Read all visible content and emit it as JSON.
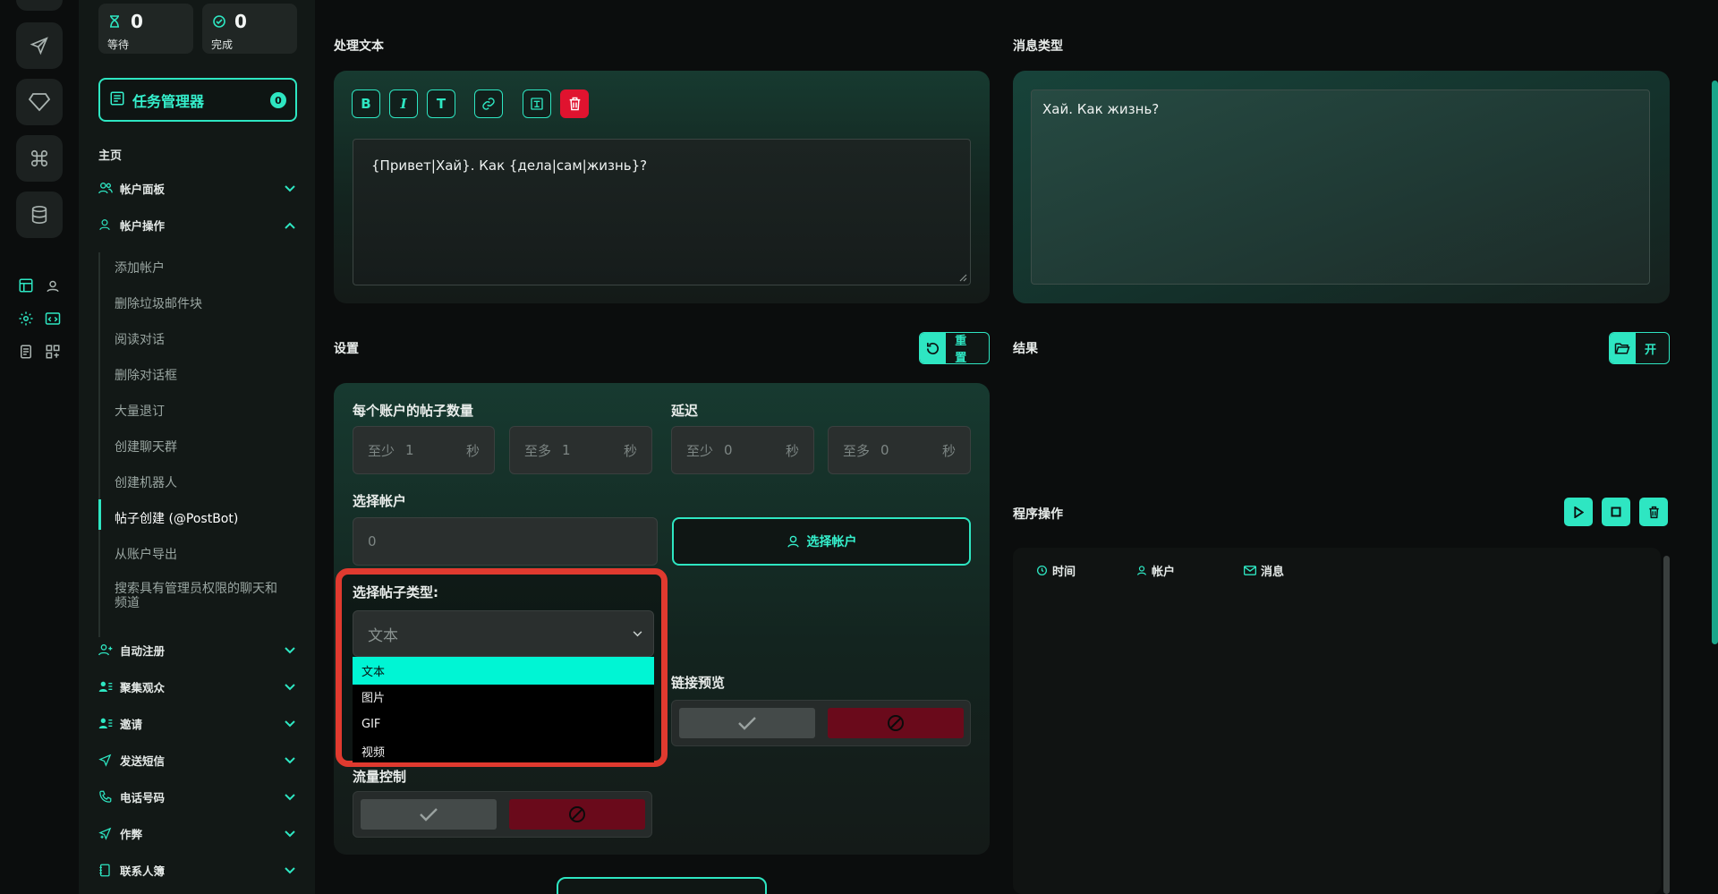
{
  "stats": [
    {
      "icon": "hourglass-icon",
      "value": "0",
      "label": "等待"
    },
    {
      "icon": "check-circle-icon",
      "value": "0",
      "label": "完成"
    }
  ],
  "task_manager": {
    "label": "任务管理器",
    "badge": "0"
  },
  "sidebar": {
    "section_title": "主页",
    "groups": [
      {
        "label": "帐户面板",
        "icon": "users-icon"
      },
      {
        "label": "帐户操作",
        "icon": "user-icon"
      }
    ],
    "sub_items": [
      "添加帐户",
      "删除垃圾邮件块",
      "阅读对话",
      "删除对话框",
      "大量退订",
      "创建聊天群",
      "创建机器人",
      "帖子创建 (@PostBot)",
      "从账户导出",
      "搜索具有管理员权限的聊天和频道"
    ],
    "active_sub": "帖子创建 (@PostBot)",
    "groups_bottom": [
      {
        "label": "自动注册"
      },
      {
        "label": "聚集观众"
      },
      {
        "label": "邀请"
      },
      {
        "label": "发送短信"
      },
      {
        "label": "电话号码"
      },
      {
        "label": "作弊"
      },
      {
        "label": "联系人簿"
      }
    ]
  },
  "text_section": {
    "title": "处理文本",
    "toolbar": {
      "bold": "B",
      "italic": "I",
      "text": "T"
    },
    "value": "{Привет|Хай}. Как {дела|сам|жизнь}?"
  },
  "message_type": {
    "title": "消息类型",
    "preview": "Хай. Как жизнь?"
  },
  "settings": {
    "title": "设置",
    "reset_label": "重置",
    "posts_per_account_label": "每个账户的帖子数量",
    "delay_label": "延迟",
    "posts_min": {
      "prefix": "至少",
      "value": "1",
      "unit": "秒"
    },
    "posts_max": {
      "prefix": "至多",
      "value": "1",
      "unit": "秒"
    },
    "delay_min": {
      "prefix": "至少",
      "value": "0",
      "unit": "秒"
    },
    "delay_max": {
      "prefix": "至多",
      "value": "0",
      "unit": "秒"
    },
    "select_account_label": "选择帐户",
    "account_count": "0",
    "select_account_button": "选择帐户",
    "post_type_label": "选择帖子类型:",
    "post_type_selected": "文本",
    "post_type_options": [
      "文本",
      "图片",
      "GIF",
      "视频"
    ],
    "link_preview_label": "链接预览",
    "flow_control_label": "流量控制"
  },
  "results": {
    "title": "结果",
    "open_label": "开"
  },
  "program_ops": {
    "title": "程序操作",
    "columns": [
      "时间",
      "帐户",
      "消息"
    ]
  },
  "colors": {
    "accent": "#2ee6c2",
    "danger": "#e0132f",
    "highlight": "#e03a2f"
  }
}
